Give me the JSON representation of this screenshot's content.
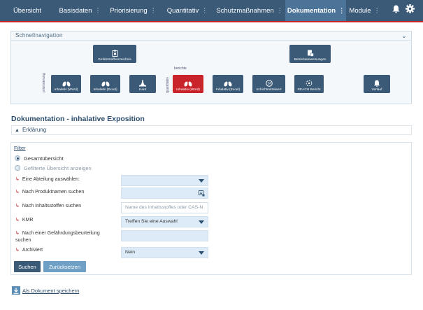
{
  "nav": {
    "items": [
      {
        "label": "Übersicht",
        "dots": ""
      },
      {
        "label": "Basisdaten",
        "dots": "⋮"
      },
      {
        "label": "Priorisierung",
        "dots": "⋮"
      },
      {
        "label": "Quantitativ",
        "dots": "⋮"
      },
      {
        "label": "Schutzmaßnahmen",
        "dots": "⋮"
      },
      {
        "label": "Dokumentation",
        "dots": "⋮"
      },
      {
        "label": "Module",
        "dots": "⋮"
      }
    ],
    "active": "Dokumentation",
    "icons": [
      "bell-icon",
      "gear-icon"
    ]
  },
  "quicknav": {
    "title": "Schnellnavigation",
    "group_labels": {
      "priorisierung": "priorisierung",
      "quantitativ": "quantitativ",
      "berichte": "berichte"
    },
    "tiles": {
      "gefahrstoff": "Gefahrstoffverzeichnis",
      "betriebs": "Betriebsanweisungen",
      "inh_word_1": "Inhalativ (Word)",
      "inh_excel_1": "Inhalativ (Excel)",
      "haut": "Haut",
      "inh_word_2": "Inhalativ (Word)",
      "inh_excel_2": "Inhalativ (Excel)",
      "schicht": "Schichtmittelwert",
      "reach": "REACH Bericht",
      "verlauf": "Verlauf"
    }
  },
  "page": {
    "title": "Dokumentation - inhalative Exposition",
    "explanation": "Erklärung"
  },
  "filter": {
    "title": "Filter",
    "radio_all": "Gesamtübersicht",
    "radio_filtered": "Gefilterte Übersicht anzeigen",
    "dept_label": "Eine Abteilung auswählen:",
    "dept_value": "",
    "product_label": "Nach Produktnamen suchen",
    "product_value": "",
    "ingredient_label": "Nach Inhaltsstoffen suchen",
    "ingredient_placeholder": "Name des Inhaltsstoffes oder CAS-N",
    "kmr_label": "KMR",
    "kmr_value": "Treffen Sie eine Auswahl",
    "assessment_label": "Nach einer Gefährdungsbeurteilung suchen",
    "assessment_value": "",
    "archived_label": "Archiviert",
    "archived_value": "Nein",
    "search_button": "Suchen",
    "reset_button": "Zurücksetzen"
  },
  "save": {
    "label": "Als Dokument speichern"
  },
  "colors": {
    "nav": "#3a5a78",
    "active": "#4c7498",
    "accent": "#c9242b"
  }
}
